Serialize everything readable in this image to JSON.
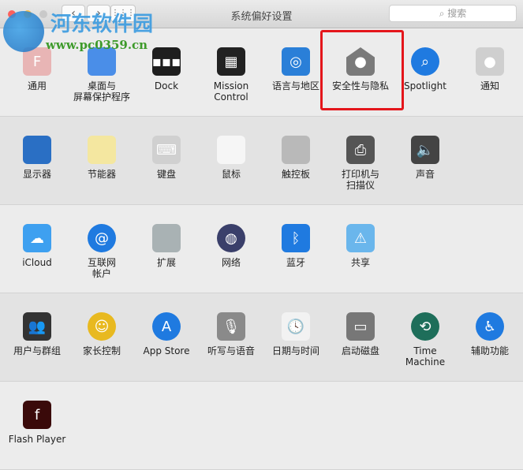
{
  "window": {
    "title": "系统偏好设置",
    "search_placeholder": "搜索",
    "back": "‹",
    "forward": "›",
    "grid": "⋮⋮⋮"
  },
  "watermark": {
    "name": "河东软件园",
    "url": "www.pc0359.cn"
  },
  "sections": [
    [
      {
        "label": "通用",
        "icon": "general-icon",
        "bg": "#e8b5b5",
        "g": "F"
      },
      {
        "label": "桌面与\n屏幕保护程序",
        "icon": "desktop-icon",
        "bg": "#4a8ee8",
        "g": ""
      },
      {
        "label": "Dock",
        "icon": "dock-icon",
        "bg": "#1e1e1e",
        "g": "▪▪▪"
      },
      {
        "label": "Mission\nControl",
        "icon": "mission-control-icon",
        "bg": "#222",
        "g": "▦"
      },
      {
        "label": "语言与地区",
        "icon": "un-flag-icon",
        "bg": "#2a7fd8",
        "g": "◎"
      },
      {
        "label": "安全性与隐私",
        "icon": "security-house-icon",
        "bg": "#7a7a7a",
        "g": "●"
      },
      {
        "label": "Spotlight",
        "icon": "spotlight-icon",
        "bg": "#1f7ae0",
        "g": "⌕"
      },
      {
        "label": "通知",
        "icon": "notifications-icon",
        "bg": "#cfcfcf",
        "g": "●"
      }
    ],
    [
      {
        "label": "显示器",
        "icon": "display-icon",
        "bg": "#2a6fc4",
        "g": ""
      },
      {
        "label": "节能器",
        "icon": "bulb-icon",
        "bg": "#f4e7a0",
        "g": ""
      },
      {
        "label": "键盘",
        "icon": "keyboard-icon",
        "bg": "#d0d0d0",
        "g": "⌨"
      },
      {
        "label": "鼠标",
        "icon": "mouse-icon",
        "bg": "#f6f6f6",
        "g": ""
      },
      {
        "label": "触控板",
        "icon": "trackpad-icon",
        "bg": "#b9b9b9",
        "g": ""
      },
      {
        "label": "打印机与\n扫描仪",
        "icon": "printer-icon",
        "bg": "#555",
        "g": "⎙"
      },
      {
        "label": "声音",
        "icon": "speaker-icon",
        "bg": "#444",
        "g": "🔈"
      }
    ],
    [
      {
        "label": "iCloud",
        "icon": "icloud-icon",
        "bg": "#3ea0f0",
        "g": "☁"
      },
      {
        "label": "互联网\n帐户",
        "icon": "at-icon",
        "bg": "#1f7ae0",
        "g": "@"
      },
      {
        "label": "扩展",
        "icon": "puzzle-icon",
        "bg": "#a9b2b4",
        "g": ""
      },
      {
        "label": "网络",
        "icon": "network-globe-icon",
        "bg": "#3a3f6a",
        "g": "◍"
      },
      {
        "label": "蓝牙",
        "icon": "bluetooth-icon",
        "bg": "#1f7ae0",
        "g": "ᛒ"
      },
      {
        "label": "共享",
        "icon": "sharing-folder-icon",
        "bg": "#6ab6ec",
        "g": "⚠"
      }
    ],
    [
      {
        "label": "用户与群组",
        "icon": "users-icon",
        "bg": "#333",
        "g": "👥"
      },
      {
        "label": "家长控制",
        "icon": "parental-controls-icon",
        "bg": "#e8b920",
        "g": "☺"
      },
      {
        "label": "App Store",
        "icon": "app-store-icon",
        "bg": "#1f7ae0",
        "g": "A"
      },
      {
        "label": "听写与语音",
        "icon": "microphone-icon",
        "bg": "#8a8a8a",
        "g": "🎙"
      },
      {
        "label": "日期与时间",
        "icon": "clock-calendar-icon",
        "bg": "#f2f2f2",
        "g": "🕓"
      },
      {
        "label": "启动磁盘",
        "icon": "disk-icon",
        "bg": "#777",
        "g": "▭"
      },
      {
        "label": "Time Machine",
        "icon": "time-machine-icon",
        "bg": "#1e6e5a",
        "g": "⟲"
      },
      {
        "label": "辅助功能",
        "icon": "accessibility-icon",
        "bg": "#1f7ae0",
        "g": "♿"
      }
    ],
    [
      {
        "label": "Flash Player",
        "icon": "flash-player-icon",
        "bg": "#3a0a0a",
        "g": "f"
      }
    ]
  ]
}
